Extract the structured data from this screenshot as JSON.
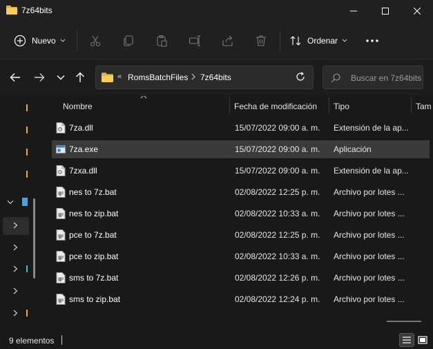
{
  "window": {
    "title": "7z64bits",
    "folder_color": "#f2c14e"
  },
  "toolbar": {
    "new_label": "Nuevo",
    "sort_label": "Ordenar",
    "icons": [
      "cut-icon",
      "copy-icon",
      "paste-icon",
      "rename-icon",
      "share-icon",
      "delete-icon"
    ]
  },
  "address": {
    "overflow": "«",
    "segments": [
      "RomsBatchFiles",
      "7z64bits"
    ]
  },
  "search": {
    "placeholder": "Buscar en 7z64bits"
  },
  "columns": {
    "name": "Nombre",
    "date": "Fecha de modificación",
    "type": "Tipo",
    "size": "Tam"
  },
  "files": [
    {
      "name": "7za.dll",
      "date": "15/07/2022 09:00 a. m.",
      "type": "Extensión de la ap...",
      "icon": "dll-file-icon"
    },
    {
      "name": "7za.exe",
      "date": "15/07/2022 09:00 a. m.",
      "type": "Aplicación",
      "icon": "exe-file-icon",
      "selected": true
    },
    {
      "name": "7zxa.dll",
      "date": "15/07/2022 09:00 a. m.",
      "type": "Extensión de la ap...",
      "icon": "dll-file-icon"
    },
    {
      "name": "nes to 7z.bat",
      "date": "02/08/2022 12:25 p. m.",
      "type": "Archivo por lotes ...",
      "icon": "bat-file-icon"
    },
    {
      "name": "nes to zip.bat",
      "date": "02/08/2022 10:33 a. m.",
      "type": "Archivo por lotes ...",
      "icon": "bat-file-icon"
    },
    {
      "name": "pce to 7z.bat",
      "date": "02/08/2022 12:25 p. m.",
      "type": "Archivo por lotes ...",
      "icon": "bat-file-icon"
    },
    {
      "name": "pce to zip.bat",
      "date": "02/08/2022 10:33 a. m.",
      "type": "Archivo por lotes ...",
      "icon": "bat-file-icon"
    },
    {
      "name": "sms to 7z.bat",
      "date": "02/08/2022 12:26 p. m.",
      "type": "Archivo por lotes ...",
      "icon": "bat-file-icon"
    },
    {
      "name": "sms to zip.bat",
      "date": "02/08/2022 12:24 p. m.",
      "type": "Archivo por lotes ...",
      "icon": "bat-file-icon"
    }
  ],
  "status": {
    "count": "9 elementos"
  }
}
